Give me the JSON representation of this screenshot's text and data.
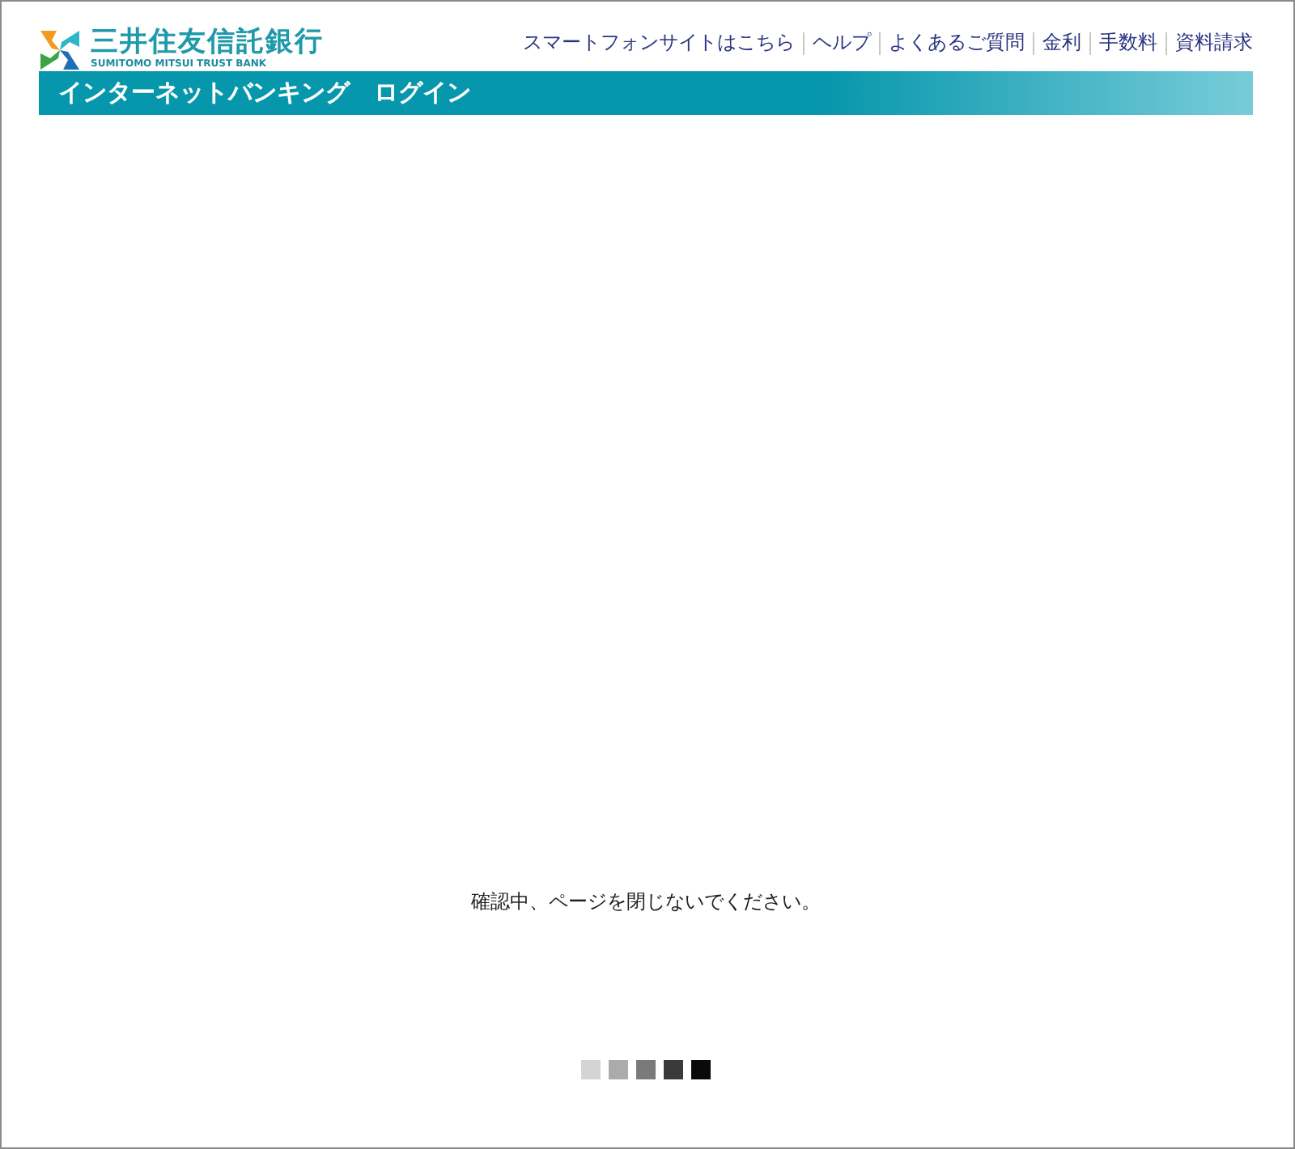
{
  "logo": {
    "name": "三井住友信託銀行",
    "subtitle": "SUMITOMO MITSUI TRUST BANK"
  },
  "header_links": [
    "スマートフォンサイトはこちら",
    "ヘルプ",
    "よくあるご質問",
    "金利",
    "手数料",
    "資料請求"
  ],
  "title_bar": {
    "title": "インターネットバンキング　ログイン"
  },
  "message": "確認中、ページを閉じないでください。",
  "loader": [
    {
      "color": "#d4d4d4"
    },
    {
      "color": "#ababab"
    },
    {
      "color": "#7a7a7a"
    },
    {
      "color": "#3a3a3a"
    },
    {
      "color": "#0a0a0a"
    }
  ]
}
